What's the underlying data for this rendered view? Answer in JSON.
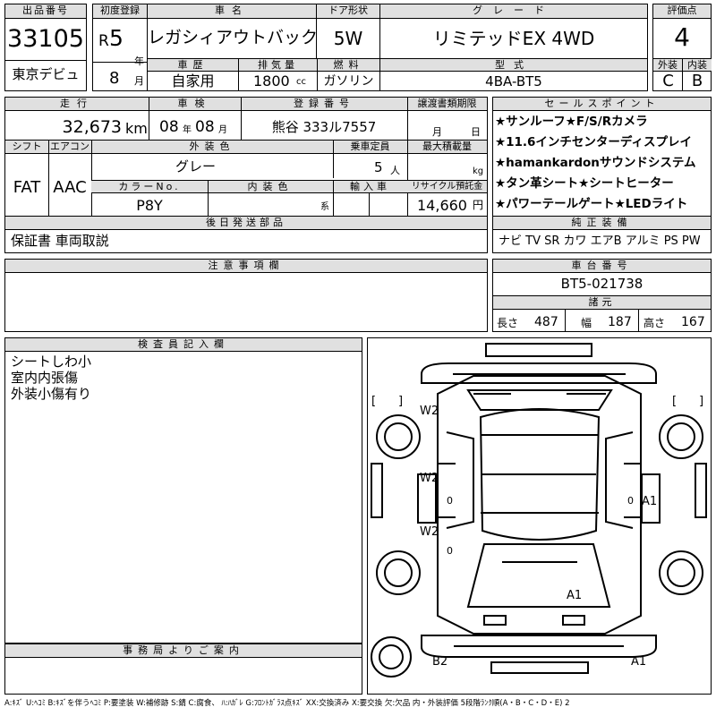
{
  "header": {
    "lot_label": "出品番号",
    "lot_number": "33105",
    "first_reg_label": "初度登録",
    "era": "R",
    "year": "5",
    "year_unit": "年",
    "month": "8",
    "month_unit": "月",
    "car_name_label": "車名",
    "car_name": "レガシィアウトバック",
    "door_label": "ドア形状",
    "door": "5W",
    "grade_label": "グレード",
    "grade": "リミテッドEX 4WD",
    "score_label": "評価点",
    "score": "4",
    "venue": "東京デビュ",
    "history_label": "車歴",
    "history": "自家用",
    "displacement_label": "排気量",
    "displacement": "1800",
    "displacement_unit": "cc",
    "fuel_label": "燃料",
    "fuel": "ガソリン",
    "model_label": "型式",
    "model": "4BA-BT5",
    "exterior_label": "外装",
    "exterior_grade": "C",
    "interior_label": "内装",
    "interior_grade": "B"
  },
  "details": {
    "mileage_label": "走行",
    "mileage": "32,673",
    "mileage_unit": "km",
    "inspection_label": "車検",
    "insp_year": "08",
    "insp_year_unit": "年",
    "insp_month": "08",
    "insp_month_unit": "月",
    "reg_label": "登録番号",
    "reg_number": "熊谷 333ル7557",
    "deadline_label": "譲渡書類期限",
    "deadline_month_unit": "月",
    "deadline_day_unit": "日",
    "shift_label": "シフト",
    "shift": "FAT",
    "aircon_label": "エアコン",
    "aircon": "AAC",
    "color_label": "外装色",
    "color": "グレー",
    "capacity_label": "乗車定員",
    "capacity": "5",
    "capacity_unit": "人",
    "maxload_label": "最大積載量",
    "maxload_unit": "kg",
    "colorno_label": "カラーNo.",
    "colorno": "P8Y",
    "intcolor_label": "内装色",
    "intcolor_unit": "系",
    "import_label": "輸入車",
    "recycle_label": "リサイクル預託金",
    "recycle": "14,660",
    "recycle_unit": "円"
  },
  "sales": {
    "title": "セールスポイント",
    "points": [
      "★サンルーフ★F/S/Rカメラ",
      "★11.6インチセンターディスプレイ",
      "★hamankardonサウンドシステム",
      "★タン革シート★シートヒーター",
      "★パワーテールゲート★LEDライト"
    ]
  },
  "later": {
    "title": "後日発送部品",
    "text": "保証書 車両取説"
  },
  "equipment": {
    "title": "純正装備",
    "items": "ナビ TV SR カワ エアB アルミ PS PW"
  },
  "notes": {
    "title": "注意事項欄"
  },
  "chassis": {
    "title": "車台番号",
    "number": "BT5-021738"
  },
  "dims": {
    "title": "諸元",
    "len_label": "長さ",
    "length": "487",
    "wid_label": "幅",
    "width": "187",
    "hei_label": "高さ",
    "height": "167"
  },
  "inspector": {
    "title": "検査員記入欄",
    "lines": [
      "シートしわ小",
      "室内内張傷",
      "外装小傷有り"
    ]
  },
  "office": {
    "title": "事務局よりご案内"
  },
  "diagram": {
    "marks": [
      "W2",
      "W2",
      "W2",
      "A1",
      "A1",
      "B2",
      "A1"
    ],
    "zeros": [
      "0",
      "0",
      "0"
    ],
    "brackets": [
      "[",
      "]",
      "[",
      "]"
    ]
  },
  "legend": "A:ｷｽﾞ U:ﾍｺﾐ B:ｷｽﾞを伴うﾍｺﾐ P:要塗装 W:補修跡 S:錆 C:腐食、 ﾊ:ﾊｶﾞﾚ G:ﾌﾛﾝﾄｶﾞﾗｽ点ｷｽﾞ XX:交換済み X:要交換 欠:欠品 内・外装評価 5段階ﾗﾝｸ順(A・B・C・D・E) 2"
}
